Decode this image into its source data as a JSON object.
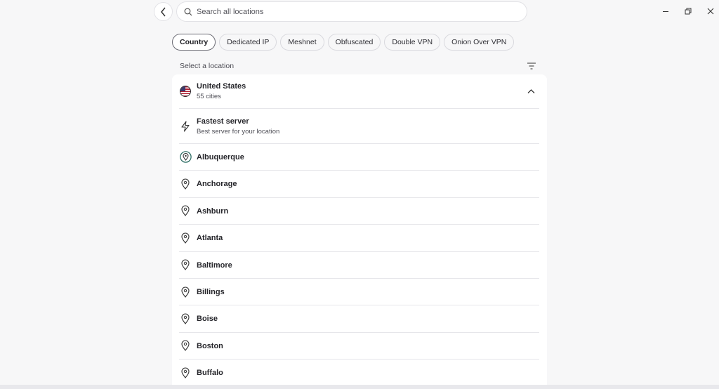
{
  "search": {
    "placeholder": "Search all locations"
  },
  "tabs": [
    {
      "label": "Country",
      "active": true
    },
    {
      "label": "Dedicated IP",
      "active": false
    },
    {
      "label": "Meshnet",
      "active": false
    },
    {
      "label": "Obfuscated",
      "active": false
    },
    {
      "label": "Double VPN",
      "active": false
    },
    {
      "label": "Onion Over VPN",
      "active": false
    }
  ],
  "section_label": "Select a location",
  "country": {
    "name": "United States",
    "cities_count": "55 cities",
    "flag_icon": "us-flag-icon",
    "expanded": true
  },
  "fastest": {
    "title": "Fastest server",
    "subtitle": "Best server for your location",
    "icon": "lightning-icon"
  },
  "cities": [
    {
      "name": "Albuquerque",
      "highlighted": true
    },
    {
      "name": "Anchorage"
    },
    {
      "name": "Ashburn"
    },
    {
      "name": "Atlanta"
    },
    {
      "name": "Baltimore"
    },
    {
      "name": "Billings"
    },
    {
      "name": "Boise"
    },
    {
      "name": "Boston"
    },
    {
      "name": "Buffalo"
    }
  ],
  "colors": {
    "background": "#f7f7f8",
    "panel": "#ffffff",
    "highlight_icon": "#2f6f66",
    "text": "#2b2b30"
  }
}
